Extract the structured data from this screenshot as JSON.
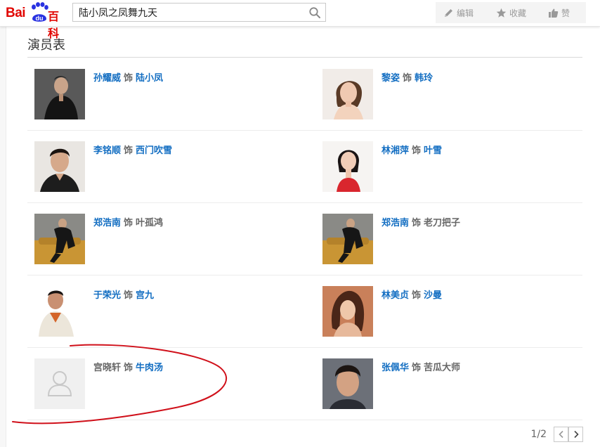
{
  "header": {
    "logo_text": "Bai",
    "logo_du": "du",
    "logo_suffix": "百科",
    "search_value": "陆小凤之凤舞九天",
    "actions": [
      {
        "label": "编辑",
        "icon": "pencil-icon"
      },
      {
        "label": "收藏",
        "icon": "star-icon"
      },
      {
        "label": "赞",
        "icon": "thumbs-up-icon"
      }
    ]
  },
  "section": {
    "title": "演员表"
  },
  "cast": [
    {
      "actor": "孙耀威",
      "role": "陆小凤",
      "actor_link": true,
      "role_link": true
    },
    {
      "actor": "黎姿",
      "role": "韩玲",
      "actor_link": true,
      "role_link": true
    },
    {
      "actor": "李铭顺",
      "role": "西门吹雪",
      "actor_link": true,
      "role_link": true
    },
    {
      "actor": "林湘萍",
      "role": "叶雪",
      "actor_link": true,
      "role_link": true
    },
    {
      "actor": "郑浩南",
      "role": "叶孤鸿",
      "actor_link": true,
      "role_link": false
    },
    {
      "actor": "郑浩南",
      "role": "老刀把子",
      "actor_link": true,
      "role_link": false
    },
    {
      "actor": "于荣光",
      "role": "宫九",
      "actor_link": true,
      "role_link": true
    },
    {
      "actor": "林美贞",
      "role": "沙曼",
      "actor_link": true,
      "role_link": true
    },
    {
      "actor": "宫晓轩",
      "role": "牛肉汤",
      "actor_link": false,
      "role_link": true
    },
    {
      "actor": "张佩华",
      "role": "苦瓜大师",
      "actor_link": true,
      "role_link": false
    }
  ],
  "cast_separator": "饰",
  "pager": {
    "current": "1/2"
  },
  "colors": {
    "link": "#136ec2",
    "brand_red": "#e10602",
    "annotation": "#d0101a"
  }
}
